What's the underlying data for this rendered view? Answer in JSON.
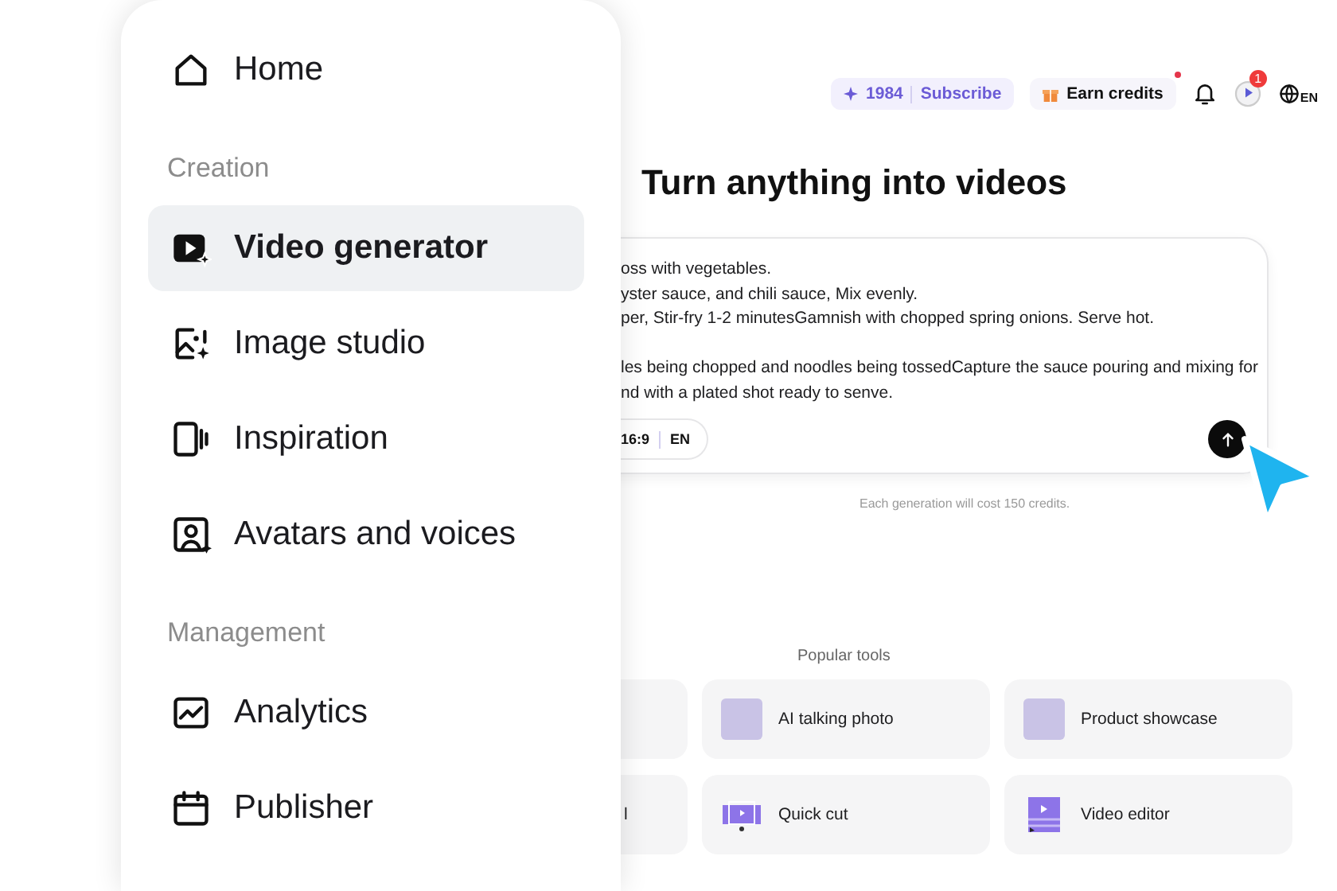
{
  "sidebar": {
    "items": [
      {
        "kind": "link",
        "label": "Home",
        "selected": false
      },
      {
        "kind": "header",
        "label": "Creation"
      },
      {
        "kind": "link",
        "label": "Video generator",
        "selected": true
      },
      {
        "kind": "link",
        "label": "Image studio",
        "selected": false
      },
      {
        "kind": "link",
        "label": "Inspiration",
        "selected": false
      },
      {
        "kind": "link",
        "label": "Avatars and voices",
        "selected": false
      },
      {
        "kind": "header",
        "label": "Management"
      },
      {
        "kind": "link",
        "label": "Analytics",
        "selected": false
      },
      {
        "kind": "link",
        "label": "Publisher",
        "selected": false
      }
    ]
  },
  "header": {
    "credits": "1984",
    "subscribe": "Subscribe",
    "earn_credits": "Earn credits",
    "earn_notification": true,
    "task_badge": "1",
    "language": "EN"
  },
  "main": {
    "title": "Turn anything into videos",
    "prompt_paragraphs": [
      [
        "oss with vegetables.",
        "yster sauce, and chili sauce, Mix evenly.",
        "per, Stir-fry 1-2 minutesGamnish with chopped spring onions. Serve hot."
      ],
      [
        "les being chopped and noodles being tossedCapture the sauce pouring and mixing for",
        "nd with a plated shot ready to senve."
      ]
    ],
    "options": [
      "16:9",
      "EN"
    ],
    "cost_note": "Each generation will cost 150 credits.",
    "popular_tools": {
      "title": "Popular tools",
      "tools": [
        {
          "kind": "partial"
        },
        {
          "kind": "photo",
          "label": "AI talking photo"
        },
        {
          "kind": "photo",
          "label": "Product showcase"
        },
        {
          "kind": "partial",
          "label": "l"
        },
        {
          "kind": "clip",
          "label": "Quick cut"
        },
        {
          "kind": "editor",
          "label": "Video editor"
        }
      ]
    }
  }
}
